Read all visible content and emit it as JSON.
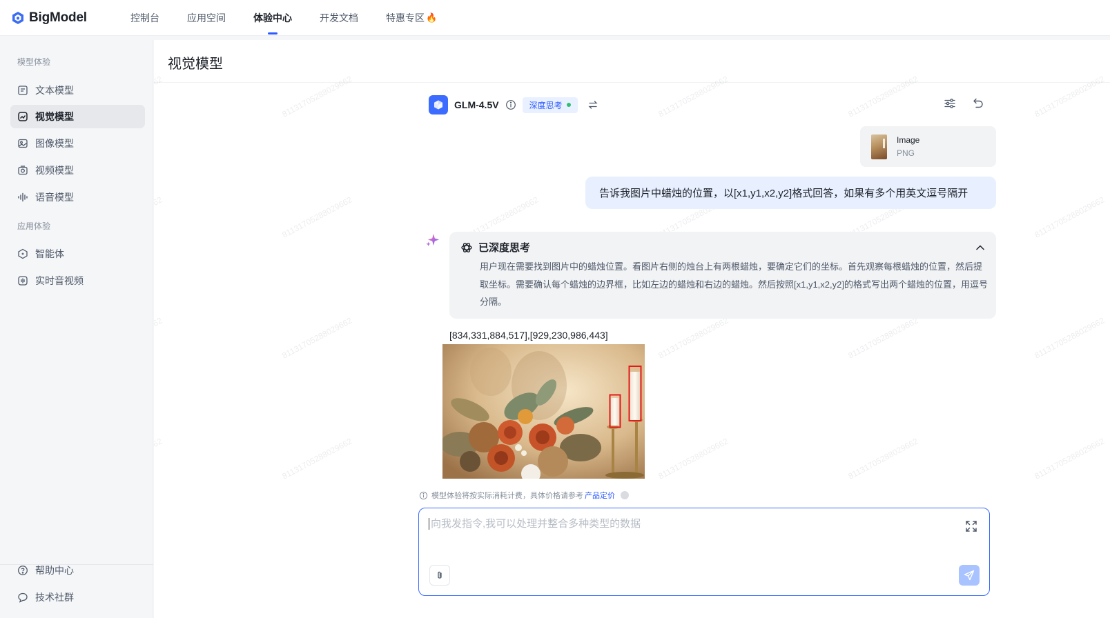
{
  "brand": {
    "name": "BigModel"
  },
  "nav": {
    "items": [
      {
        "label": "控制台"
      },
      {
        "label": "应用空间"
      },
      {
        "label": "体验中心",
        "active": true
      },
      {
        "label": "开发文档"
      },
      {
        "label": "特惠专区"
      }
    ]
  },
  "sidebar": {
    "group_model": "模型体验",
    "group_app": "应用体验",
    "items": [
      {
        "label": "文本模型",
        "icon": "text-icon"
      },
      {
        "label": "视觉模型",
        "icon": "vision-icon",
        "active": true
      },
      {
        "label": "图像模型",
        "icon": "image-icon"
      },
      {
        "label": "视频模型",
        "icon": "video-icon"
      },
      {
        "label": "语音模型",
        "icon": "voice-icon"
      },
      {
        "label": "智能体",
        "icon": "agent-icon"
      },
      {
        "label": "实时音视频",
        "icon": "realtime-icon"
      }
    ],
    "bottom_items": [
      {
        "label": "帮助中心",
        "icon": "help-icon"
      },
      {
        "label": "技术社群",
        "icon": "community-icon"
      }
    ]
  },
  "page": {
    "title": "视觉模型"
  },
  "watermark": "81131705288029662",
  "model": {
    "name": "GLM-4.5V",
    "deep_think_label": "深度思考"
  },
  "chat": {
    "attachment": {
      "title": "Image",
      "type": "PNG"
    },
    "user_message": "告诉我图片中蜡烛的位置，以[x1,y1,x2,y2]格式回答，如果有多个用英文逗号隔开",
    "thinking": {
      "title": "已深度思考",
      "text": "用户现在需要找到图片中的蜡烛位置。看图片右侧的烛台上有两根蜡烛，要确定它们的坐标。首先观察每根蜡烛的位置，然后提取坐标。需要确认每个蜡烛的边界框，比如左边的蜡烛和右边的蜡烛。然后按照[x1,y1,x2,y2]的格式写出两个蜡烛的位置，用逗号分隔。"
    },
    "answer": "[834,331,884,517],[929,230,986,443]"
  },
  "notice": {
    "text": "模型体验将按实际消耗计费，具体价格请参考",
    "link": "产品定价"
  },
  "input": {
    "placeholder": "向我发指令,我可以处理并整合多种类型的数据",
    "value": ""
  },
  "colors": {
    "accent": "#2e5bff",
    "user_bubble": "#e8f0ff",
    "send_button": "#a8c3ff",
    "annotation_box": "#e31b1b"
  }
}
